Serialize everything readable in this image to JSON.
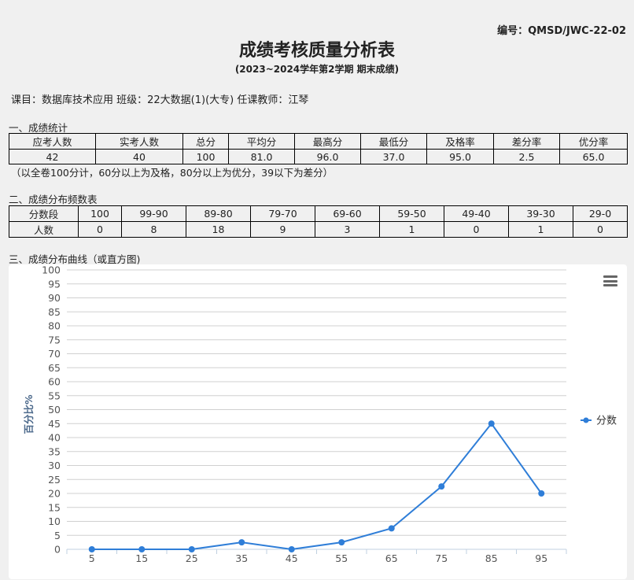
{
  "header": {
    "code": "编号：QMSD/JWC-22-02",
    "title": "成绩考核质量分析表",
    "subtitle": "(2023~2024学年第2学期  期末成绩)"
  },
  "course_info": "课目：数据库技术应用 班级：22大数据(1)(大专) 任课教师：江琴",
  "section1": {
    "title": "一、成绩统计",
    "headers": [
      "应考人数",
      "实考人数",
      "总分",
      "平均分",
      "最高分",
      "最低分",
      "及格率",
      "差分率",
      "优分率"
    ],
    "values": [
      "42",
      "40",
      "100",
      "81.0",
      "96.0",
      "37.0",
      "95.0",
      "2.5",
      "65.0"
    ],
    "note": "（以全卷100分计，60分以上为及格，80分以上为优分，39以下为差分）"
  },
  "section2": {
    "title": "二、成绩分布频数表",
    "header_label": "分数段",
    "count_label": "人数",
    "ranges": [
      "100",
      "99-90",
      "89-80",
      "79-70",
      "69-60",
      "59-50",
      "49-40",
      "39-30",
      "29-0"
    ],
    "counts": [
      "0",
      "8",
      "18",
      "9",
      "3",
      "1",
      "0",
      "1",
      "0"
    ]
  },
  "section3": {
    "title": "三、成绩分布曲线（或直方图)"
  },
  "chart_data": {
    "type": "line",
    "x": [
      5,
      15,
      25,
      35,
      45,
      55,
      65,
      75,
      85,
      95
    ],
    "series": [
      {
        "name": "分数",
        "values": [
          0,
          0,
          0,
          2.5,
          0,
          2.5,
          7.5,
          22.5,
          45,
          20
        ]
      }
    ],
    "ylabel": "百分比%",
    "ylim": [
      0,
      100
    ],
    "yticks": [
      0,
      5,
      10,
      15,
      20,
      25,
      30,
      35,
      40,
      45,
      50,
      55,
      60,
      65,
      70,
      75,
      80,
      85,
      90,
      95,
      100
    ],
    "grid": true,
    "legend": "right",
    "line_color": "#2f7ed8"
  }
}
